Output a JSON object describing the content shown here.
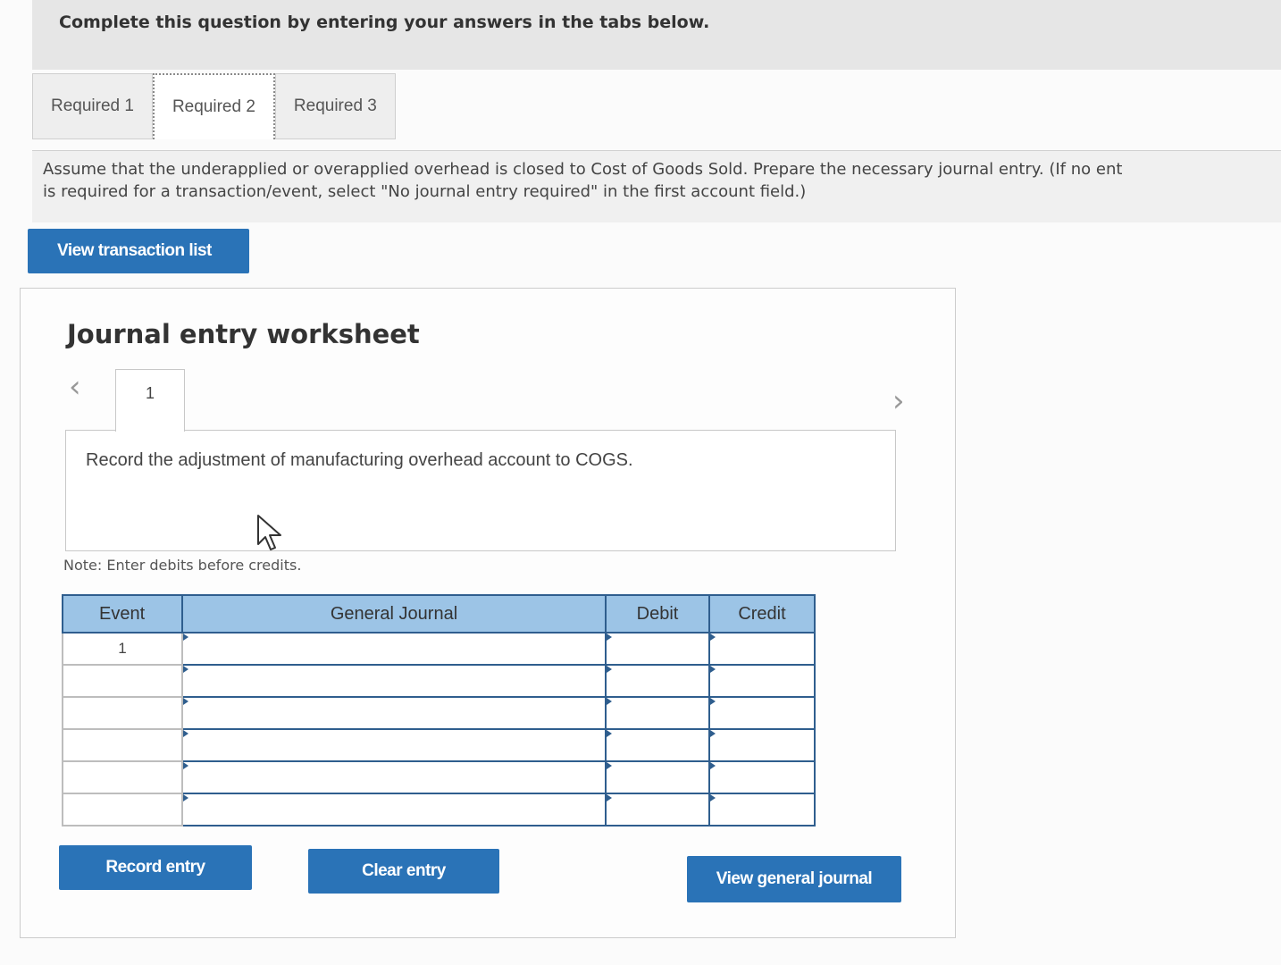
{
  "header": {
    "instruction": "Complete this question by entering your answers in the tabs below."
  },
  "tabs": [
    {
      "label": "Required 1"
    },
    {
      "label": "Required 2"
    },
    {
      "label": "Required 3"
    }
  ],
  "active_tab": "Required 2",
  "prompt": {
    "line1": "Assume that the underapplied or overapplied overhead is closed to Cost of Goods Sold. Prepare the necessary journal entry. (If no ent",
    "line2": "is required for a transaction/event, select \"No journal entry required\" in the first account field.)"
  },
  "buttons": {
    "view_transaction_list": "View transaction list",
    "record_entry": "Record entry",
    "clear_entry": "Clear entry",
    "view_general_journal": "View general journal"
  },
  "worksheet": {
    "title": "Journal entry worksheet",
    "prev_icon": "‹",
    "next_icon": "›",
    "entry_tab_label": "1",
    "description": "Record the adjustment of manufacturing overhead account to COGS.",
    "note": "Note: Enter debits before credits."
  },
  "journal": {
    "headers": {
      "event": "Event",
      "general_journal": "General Journal",
      "debit": "Debit",
      "credit": "Credit"
    },
    "rows": [
      {
        "event": "1",
        "account": "",
        "debit": "",
        "credit": ""
      },
      {
        "event": "",
        "account": "",
        "debit": "",
        "credit": ""
      },
      {
        "event": "",
        "account": "",
        "debit": "",
        "credit": ""
      },
      {
        "event": "",
        "account": "",
        "debit": "",
        "credit": ""
      },
      {
        "event": "",
        "account": "",
        "debit": "",
        "credit": ""
      },
      {
        "event": "",
        "account": "",
        "debit": "",
        "credit": ""
      }
    ]
  },
  "colors": {
    "button_blue": "#2a73b7",
    "table_header": "#9cc4e6",
    "table_border": "#2f5e8e"
  }
}
